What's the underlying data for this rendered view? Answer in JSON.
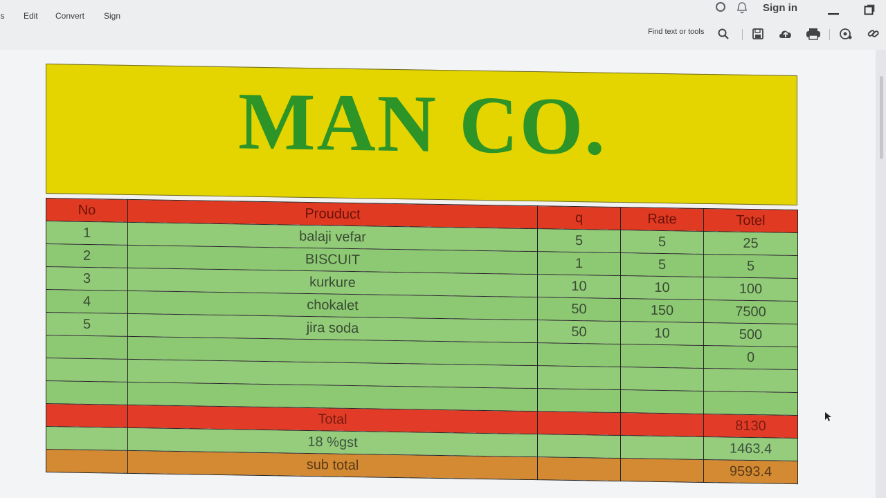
{
  "menu": {
    "items": [
      "ls",
      "Edit",
      "Convert",
      "Sign"
    ],
    "signin_label": "Sign in"
  },
  "toolbar": {
    "find_label": "Find text or tools",
    "icons": [
      "search-icon",
      "save-icon",
      "upload-icon",
      "print-icon",
      "share-icon",
      "link-icon"
    ]
  },
  "sheet": {
    "company": "MAN CO.",
    "columns": [
      "No",
      "Prouduct",
      "q",
      "Rate",
      "Totel"
    ],
    "rows": [
      {
        "no": "1",
        "product": "balaji vefar",
        "q": "5",
        "rate": "5",
        "total": "25"
      },
      {
        "no": "2",
        "product": "BISCUIT",
        "q": "1",
        "rate": "5",
        "total": "5"
      },
      {
        "no": "3",
        "product": "kurkure",
        "q": "10",
        "rate": "10",
        "total": "100"
      },
      {
        "no": "4",
        "product": "chokalet",
        "q": "50",
        "rate": "150",
        "total": "7500"
      },
      {
        "no": "5",
        "product": "jira soda",
        "q": "50",
        "rate": "10",
        "total": "500"
      },
      {
        "no": "",
        "product": "",
        "q": "",
        "rate": "",
        "total": "0"
      },
      {
        "no": "",
        "product": "",
        "q": "",
        "rate": "",
        "total": ""
      },
      {
        "no": "",
        "product": "",
        "q": "",
        "rate": "",
        "total": ""
      }
    ],
    "total_label": "Total",
    "total_value": "8130",
    "gst_label": "18 %gst",
    "gst_value": "1463.4",
    "subtotal_label": "sub total",
    "subtotal_value": "9593.4"
  },
  "colors": {
    "header_yellow": "#e4d400",
    "company_green": "#2d9427",
    "header_red": "#e03a22",
    "row_green": "#8dc873",
    "subtotal_orange": "#d38a33"
  }
}
